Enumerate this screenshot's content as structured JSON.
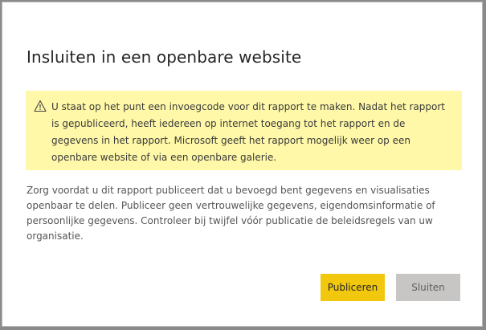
{
  "dialog": {
    "title": "Insluiten in een openbare website",
    "warning_icon": "warning-triangle-icon",
    "warning_text": "U staat op het punt een invoegcode voor dit rapport te maken. Nadat het rapport is gepubliceerd, heeft iedereen op internet toegang tot het rapport en de gegevens in het rapport. Microsoft geeft het rapport mogelijk weer op een openbare website of via een openbare galerie.",
    "body_text": "Zorg voordat u dit rapport publiceert dat u bevoegd bent gegevens en visualisaties openbaar te delen. Publiceer geen vertrouwelijke gegevens, eigendomsinformatie of persoonlijke gegevens. Controleer bij twijfel vóór publicatie de beleidsregels van uw organisatie.",
    "primary_button": "Publiceren",
    "secondary_button": "Sluiten"
  },
  "colors": {
    "warning_background": "#fff8a8",
    "primary_button": "#f2c80f",
    "secondary_button": "#c8c6c4"
  }
}
